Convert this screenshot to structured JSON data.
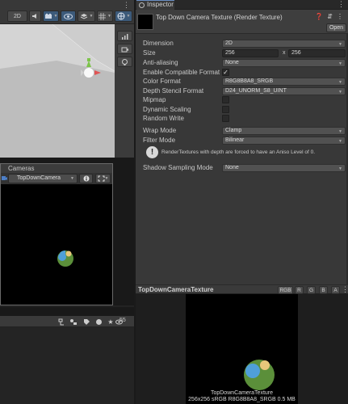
{
  "scene": {
    "toolbar": {
      "mode_2d": "2D",
      "audio_icon": "speaker-icon",
      "fx_icon": "effects-icon",
      "visibility_icon": "eye-icon",
      "grid_icon": "grid-icon",
      "gizmos_icon": "gizmo-icon",
      "menu_icon": "kebab-icon"
    }
  },
  "cameras": {
    "title": "Cameras",
    "selected_camera": "TopDownCamera",
    "info_icon": "info-icon",
    "fit_icon": "fit-frame-icon"
  },
  "bottom_panel": {
    "search_count": "55"
  },
  "inspector": {
    "tab_label": "Inspector",
    "asset_title": "Top Down Camera Texture (Render Texture)",
    "open_label": "Open",
    "properties": {
      "dimension": {
        "label": "Dimension",
        "value": "2D"
      },
      "size": {
        "label": "Size",
        "width": "256",
        "x_label": "x",
        "height": "256"
      },
      "anti_aliasing": {
        "label": "Anti-aliasing",
        "value": "None"
      },
      "enable_compatible_format": {
        "label": "Enable Compatible Format",
        "checked": "✓"
      },
      "color_format": {
        "label": "Color Format",
        "value": "R8G8B8A8_SRGB"
      },
      "depth_stencil_format": {
        "label": "Depth Stencil Format",
        "value": "D24_UNORM_S8_UINT"
      },
      "mipmap": {
        "label": "Mipmap"
      },
      "dynamic_scaling": {
        "label": "Dynamic Scaling"
      },
      "random_write": {
        "label": "Random Write"
      },
      "wrap_mode": {
        "label": "Wrap Mode",
        "value": "Clamp"
      },
      "filter_mode": {
        "label": "Filter Mode",
        "value": "Bilinear"
      },
      "help_message": "RenderTextures with depth are forced to have an Aniso Level of 0.",
      "shadow_sampling_mode": {
        "label": "Shadow Sampling Mode",
        "value": "None"
      }
    },
    "preview": {
      "title": "TopDownCameraTexture",
      "channels": [
        "RGB",
        "R",
        "G",
        "B",
        "A"
      ],
      "caption_name": "TopDownCameraTexture",
      "caption_info": "256x256 sRGB  R8G8B8A8_SRGB  0.5 MB"
    }
  },
  "colors": {
    "planet_green": "#5b8f3a",
    "planet_blue": "#4f9fd8",
    "planet_yellow": "#e8c77a"
  }
}
